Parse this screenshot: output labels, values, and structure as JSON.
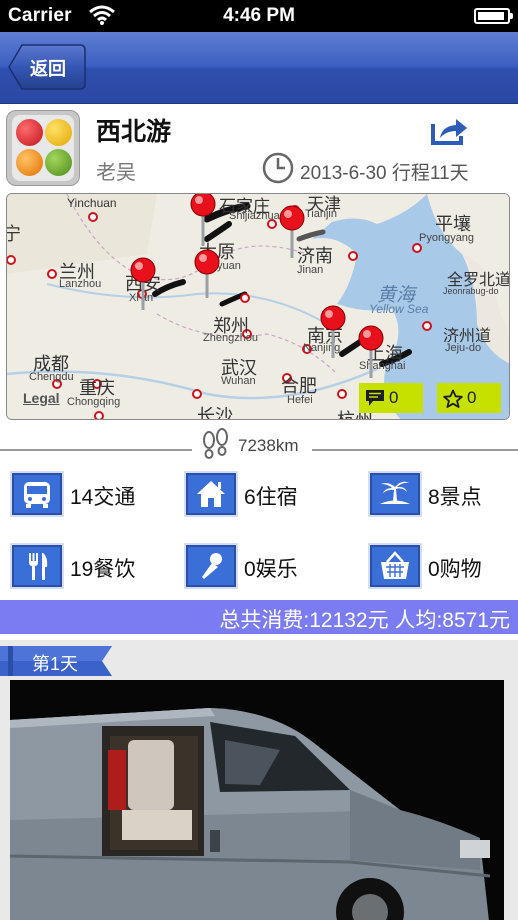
{
  "status_bar": {
    "carrier": "Carrier",
    "time": "4:46 PM",
    "battery_level": 0.92
  },
  "nav": {
    "back_label": "返回"
  },
  "trip": {
    "title": "西北游",
    "author": "老吴",
    "date": "2013-6-30",
    "duration": "行程11天"
  },
  "map": {
    "labels": [
      {
        "zh": "石家庄",
        "en": "Shijiazhuang"
      },
      {
        "zh": "天津",
        "en": "Tianjin"
      },
      {
        "zh": "平壤",
        "en": "Pyongyang"
      },
      {
        "zh": "兰州",
        "en": "Lanzhou"
      },
      {
        "zh": "西安",
        "en": "Xi'an"
      },
      {
        "zh": "太原",
        "en": "Taiyuan"
      },
      {
        "zh": "济南",
        "en": "Jinan"
      },
      {
        "zh": "全罗北道",
        "en": "Jeonrabug-do"
      },
      {
        "zh": "郑州",
        "en": "Zhengzhou"
      },
      {
        "zh": "黄海",
        "en": "Yellow Sea"
      },
      {
        "zh": "济州道",
        "en": "Jeju-do"
      },
      {
        "zh": "成都",
        "en": "Chengdu"
      },
      {
        "zh": "武汉",
        "en": "Wuhan"
      },
      {
        "zh": "南京",
        "en": "Nanjing"
      },
      {
        "zh": "重庆",
        "en": "Chongqing"
      },
      {
        "zh": "合肥",
        "en": "Hefei"
      },
      {
        "zh": "上海",
        "en": "Shanghai"
      },
      {
        "zh": "长沙",
        "en": ""
      },
      {
        "zh": "杭州",
        "en": ""
      },
      {
        "zh": "宁",
        "en": ""
      },
      {
        "zh": "",
        "en": "Yinchuan"
      }
    ],
    "legal": "Legal",
    "comments_count": "0",
    "favorites_count": "0"
  },
  "distance": "7238km",
  "categories": [
    {
      "icon": "bus-icon",
      "label": "14交通"
    },
    {
      "icon": "house-icon",
      "label": "6住宿"
    },
    {
      "icon": "island-icon",
      "label": "8景点"
    },
    {
      "icon": "fork-knife-icon",
      "label": "19餐饮"
    },
    {
      "icon": "microphone-icon",
      "label": "0娱乐"
    },
    {
      "icon": "basket-icon",
      "label": "0购物"
    }
  ],
  "cost": {
    "text": "总共消费:12132元 人均:8571元"
  },
  "day": {
    "label": "第1天"
  },
  "colors": {
    "nav_bar": "#3c5fc0",
    "category_icon": "#3b6fd8",
    "cost_bar": "#7b7cf2",
    "badge": "#c6e000",
    "pin": "#e8101a",
    "day_tag": "#3a62c8"
  }
}
